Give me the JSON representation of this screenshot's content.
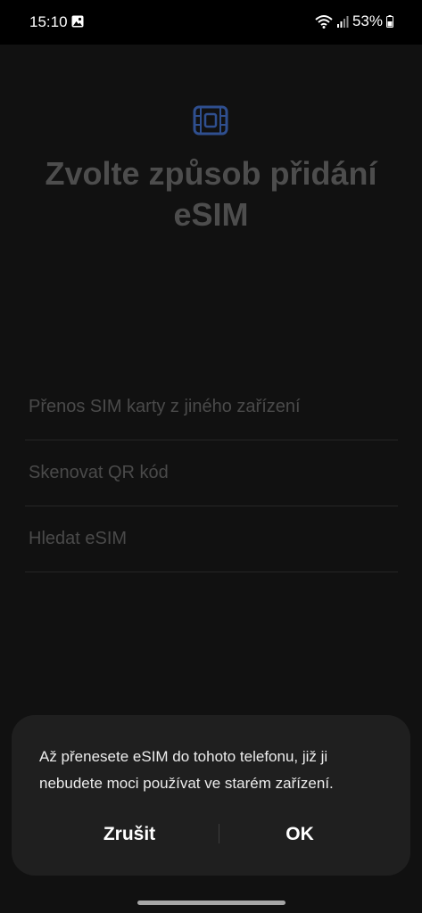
{
  "status_bar": {
    "time": "15:10",
    "battery_percent": "53%",
    "icons": [
      "gallery-icon",
      "wifi-icon",
      "signal-icon",
      "battery-icon"
    ]
  },
  "screen": {
    "icon": "esim-chip-icon",
    "title": "Zvolte způsob přidání eSIM",
    "options": [
      {
        "label": "Přenos SIM karty z jiného zařízení"
      },
      {
        "label": "Skenovat QR kód"
      },
      {
        "label": "Hledat eSIM"
      }
    ]
  },
  "dialog": {
    "message": "Až přenesete eSIM do tohoto telefonu, již ji nebudete moci používat ve starém zařízení.",
    "cancel_label": "Zrušit",
    "ok_label": "OK"
  },
  "colors": {
    "accent_icon": "#2f4f8f",
    "background": "#111111",
    "dialog_background": "#1f1f1f"
  }
}
